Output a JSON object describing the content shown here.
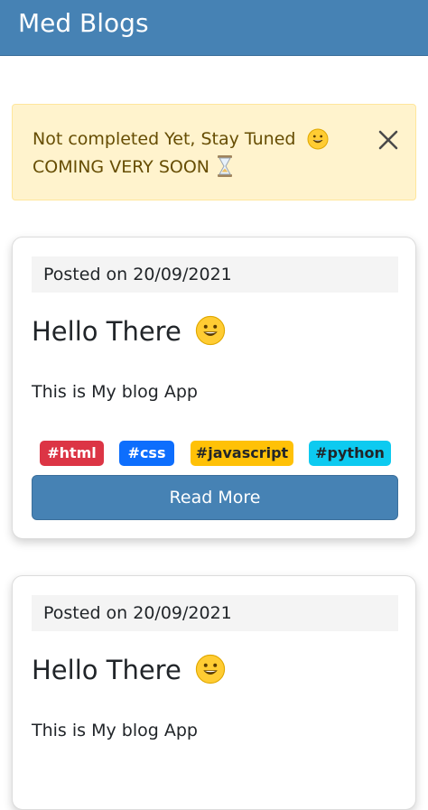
{
  "navbar": {
    "brand": "Med Blogs"
  },
  "alert": {
    "line1": "Not completed Yet, Stay Tuned",
    "line2": "COMING VERY SOON"
  },
  "posts": [
    {
      "posted": "Posted on 20/09/2021",
      "title": "Hello There",
      "body": "This is My blog App",
      "tags": [
        "#html",
        "#css",
        "#javascript",
        "#python"
      ],
      "read_more_label": "Read More"
    },
    {
      "posted": "Posted on 20/09/2021",
      "title": "Hello There",
      "body": "This is My blog App"
    }
  ],
  "colors": {
    "navbar": "#4682b4",
    "alert_bg": "#fff3cd",
    "tag_html": "#dc3545",
    "tag_css": "#0d6efd",
    "tag_javascript": "#ffc107",
    "tag_python": "#0dcaf0"
  },
  "icons": {
    "alert_emoji": "grinning-face-icon",
    "alert_hourglass": "hourglass-icon",
    "close": "close-icon",
    "title_emoji": "grinning-face-icon"
  }
}
